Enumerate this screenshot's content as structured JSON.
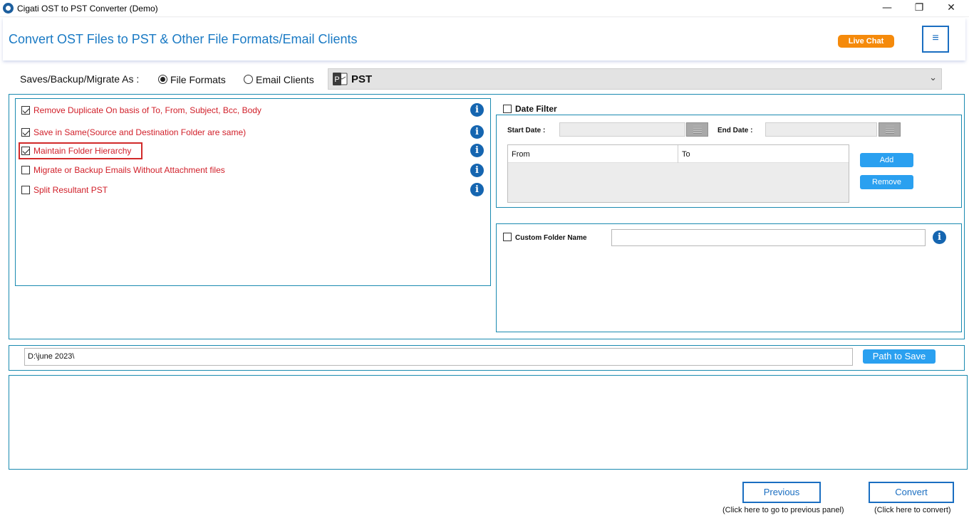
{
  "window": {
    "title": "Cigati OST to PST Converter (Demo)",
    "minimize": "—",
    "maximize": "❐",
    "close": "✕"
  },
  "header": {
    "title": "Convert OST Files to PST & Other File Formats/Email Clients",
    "live_chat": "Live Chat",
    "menu_icon": "hamburger-icon"
  },
  "saves": {
    "label": "Saves/Backup/Migrate As :",
    "options": [
      {
        "label": "File Formats",
        "selected": true
      },
      {
        "label": "Email Clients",
        "selected": false
      }
    ],
    "format_selected": "PST",
    "format_icon_letter": "P"
  },
  "options": [
    {
      "label": "Remove Duplicate On basis of To, From, Subject, Bcc, Body",
      "checked": true
    },
    {
      "label": "Save in Same(Source and Destination Folder are same)",
      "checked": true
    },
    {
      "label": "Maintain Folder Hierarchy",
      "checked": true
    },
    {
      "label": "Migrate or Backup Emails Without Attachment files",
      "checked": false
    },
    {
      "label": "Split Resultant PST",
      "checked": false
    }
  ],
  "info_glyph": "i",
  "date_filter": {
    "label": "Date Filter",
    "checked": false,
    "start_label": "Start Date :",
    "end_label": "End Date :",
    "from_header": "From",
    "to_header": "To",
    "add_label": "Add",
    "remove_label": "Remove"
  },
  "custom_folder": {
    "label": "Custom Folder Name",
    "checked": false,
    "value": ""
  },
  "path": {
    "value": "D:\\june 2023\\",
    "button": "Path to Save"
  },
  "footer": {
    "previous_label": "Previous",
    "previous_hint": "(Click here to go to previous panel)",
    "convert_label": "Convert",
    "convert_hint": "(Click here to convert)"
  },
  "colors": {
    "accent": "#1a7ac4",
    "option_text": "#d1202a",
    "live_chat": "#f58a0b",
    "button_blue": "#2aa0f0",
    "frame": "#1a8ab0"
  }
}
